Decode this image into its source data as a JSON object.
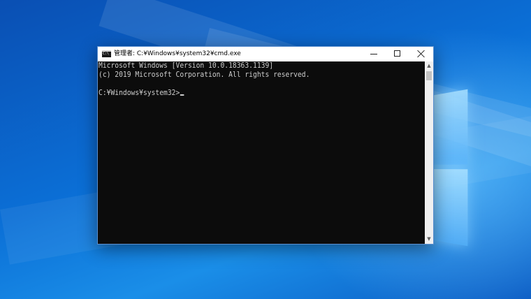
{
  "window": {
    "title": "管理者: C:¥Windows¥system32¥cmd.exe",
    "icon_text": "C:\\",
    "minimize_icon": "minimize-icon",
    "maximize_icon": "maximize-icon",
    "close_icon": "close-icon"
  },
  "console": {
    "lines": [
      "Microsoft Windows [Version 10.0.18363.1139]",
      "(c) 2019 Microsoft Corporation. All rights reserved.",
      "",
      "C:¥Windows¥system32>"
    ]
  },
  "scrollbar": {
    "up_arrow": "▲",
    "down_arrow": "▼"
  },
  "colors": {
    "console_bg": "#0c0c0c",
    "console_text": "#cccccc",
    "desktop_bg": "#0b6fd6"
  }
}
